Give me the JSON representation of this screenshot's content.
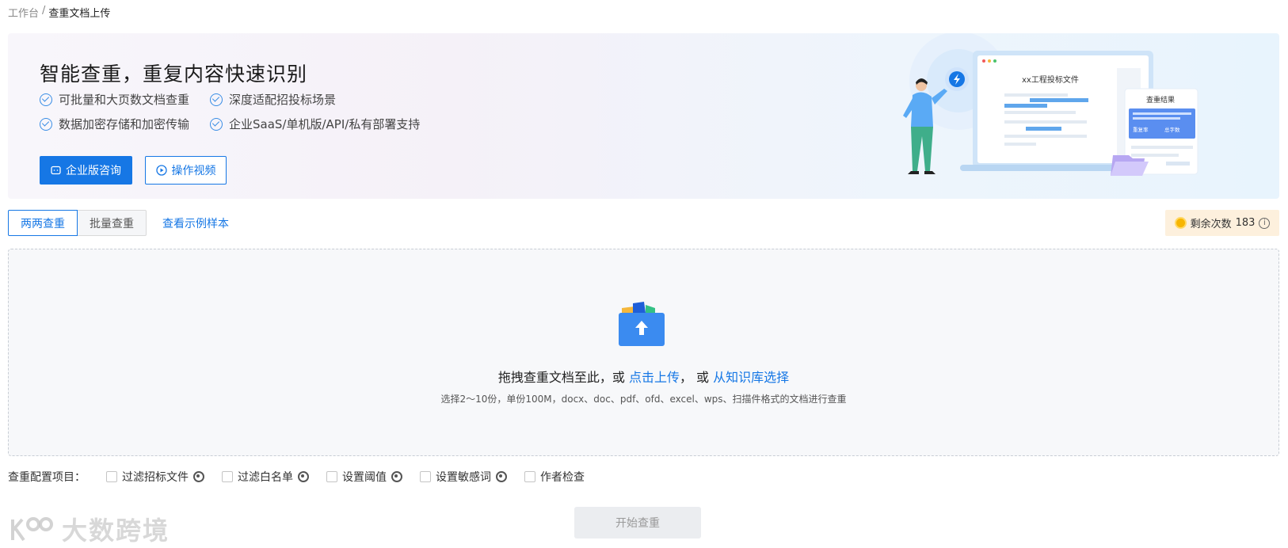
{
  "breadcrumb": {
    "root": "工作台",
    "separator": "/",
    "current": "查重文档上传"
  },
  "banner": {
    "title": "智能查重，重复内容快速识别",
    "features": [
      "可批量和大页数文档查重",
      "深度适配招投标场景",
      "数据加密存储和加密传输",
      "企业SaaS/单机版/API/私有部署支持"
    ],
    "btn_consult": "企业版咨询",
    "btn_video": "操作视频",
    "illus": {
      "doc_title": "xx工程投标文件",
      "result_title": "查重结果",
      "rate_label": "重复率",
      "words_label": "总字数"
    }
  },
  "tabs": [
    {
      "label": "两两查重",
      "active": true
    },
    {
      "label": "批量查重",
      "active": false
    }
  ],
  "sample_link": "查看示例样本",
  "remain": {
    "label": "剩余次数",
    "count": "183"
  },
  "upload": {
    "main_prefix": "拖拽查重文档至此，或",
    "upload_link": "点击上传",
    "separator": "， 或",
    "kb_link": "从知识库选择",
    "hint": "选择2～10份，单份100M，docx、doc、pdf、ofd、excel、wps、扫描件格式的文档进行查重"
  },
  "config": {
    "label": "查重配置项目：",
    "items": [
      {
        "label": "过滤招标文件",
        "gear": true
      },
      {
        "label": "过滤白名单",
        "gear": true
      },
      {
        "label": "设置阈值",
        "gear": true
      },
      {
        "label": "设置敏感词",
        "gear": true
      },
      {
        "label": "作者检查",
        "gear": false
      }
    ]
  },
  "start_button": "开始查重",
  "watermark": "大数跨境",
  "colors": {
    "primary": "#1677e5",
    "remain_bg": "#fdf0dd",
    "dropzone_bg": "#f7f8fa"
  }
}
